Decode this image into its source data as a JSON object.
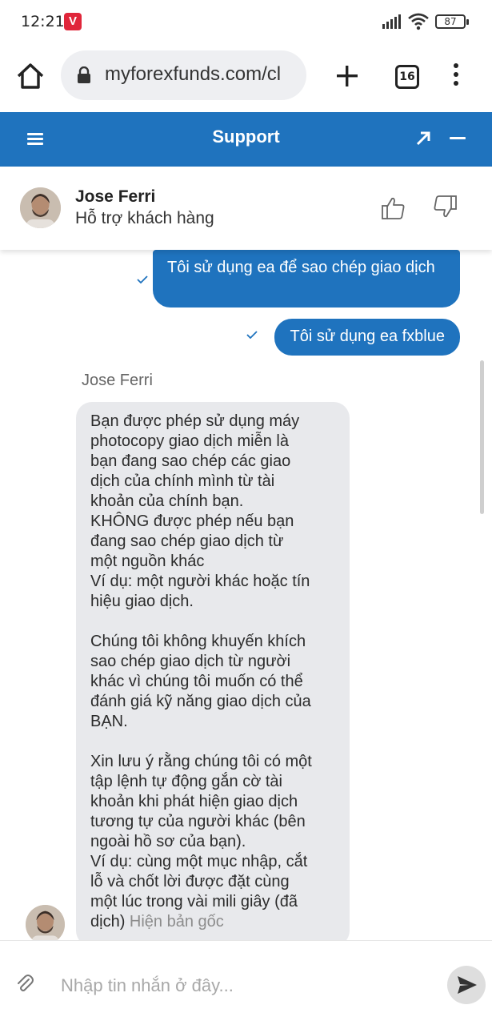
{
  "status_bar": {
    "time": "12:21",
    "notification_app": "V",
    "battery": "87"
  },
  "browser": {
    "url": "myforexfunds.com/cl",
    "tab_count": "16"
  },
  "support": {
    "title": "Support"
  },
  "agent": {
    "name": "Jose Ferri",
    "role": "Hỗ trợ khách hàng"
  },
  "chat": {
    "outgoing": [
      "Tôi sử dụng ea để sao chép giao dịch",
      "Tôi sử dụng ea fxblue"
    ],
    "incoming_sender": "Jose Ferri",
    "incoming_lines": [
      "Bạn được phép sử dụng máy",
      "photocopy giao dịch miễn là",
      "bạn đang sao chép các giao",
      "dịch của chính mình từ tài",
      "khoản của chính bạn.",
      "KHÔNG được phép nếu bạn",
      "đang sao chép giao dịch từ",
      "một nguồn khác",
      "Ví dụ: một người khác hoặc tín",
      "hiệu giao dịch.",
      "",
      "Chúng tôi không khuyến khích",
      "sao chép giao dịch từ người",
      "khác vì chúng tôi muốn có thể",
      "đánh giá kỹ năng giao dịch của",
      "BẠN.",
      "",
      "Xin lưu ý rằng chúng tôi có một",
      "tập lệnh tự động gắn cờ tài",
      "khoản khi phát hiện giao dịch",
      "tương tự của người khác (bên",
      "ngoài hồ sơ của bạn).",
      "Ví dụ: cùng một mục nhập, cắt",
      "lỗ và chốt lời được đặt cùng",
      "một lúc trong vài mili giây (đã"
    ],
    "incoming_last_line": "dịch)",
    "show_original": "Hiện bản gốc"
  },
  "input": {
    "placeholder": "Nhập tin nhắn ở đây..."
  },
  "colors": {
    "brand_blue": "#1f73be",
    "incoming_bubble": "#e8e9ec"
  },
  "icons": [
    "home-icon",
    "lock-icon",
    "plus-icon",
    "tabs-icon",
    "more-icon",
    "menu-icon",
    "expand-icon",
    "minimize-icon",
    "thumbs-up-icon",
    "thumbs-down-icon",
    "check-icon",
    "attach-icon",
    "send-icon"
  ]
}
